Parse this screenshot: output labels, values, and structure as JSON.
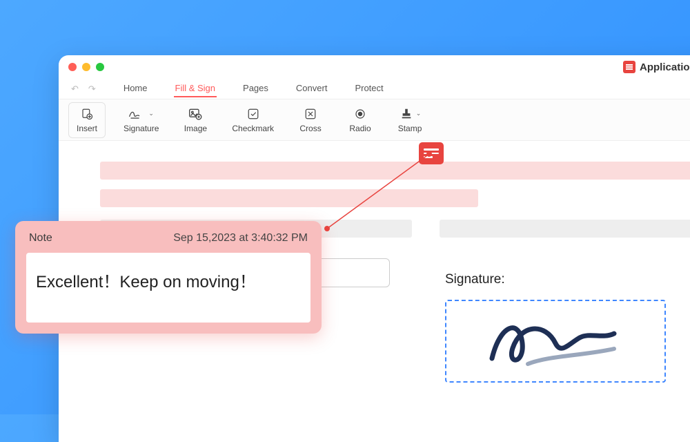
{
  "window": {
    "filename": "Application-R-.pdf"
  },
  "menus": {
    "home": "Home",
    "fill_sign": "Fill & Sign",
    "pages": "Pages",
    "convert": "Convert",
    "protect": "Protect"
  },
  "tools": {
    "insert": "Insert",
    "signature": "Signature",
    "image": "Image",
    "checkmark": "Checkmark",
    "cross": "Cross",
    "radio": "Radio",
    "stamp": "Stamp"
  },
  "signature": {
    "label": "Signature:"
  },
  "note": {
    "title": "Note",
    "timestamp": "Sep 15,2023 at 3:40:32 PM",
    "body": "Excellent！Keep on moving！"
  }
}
